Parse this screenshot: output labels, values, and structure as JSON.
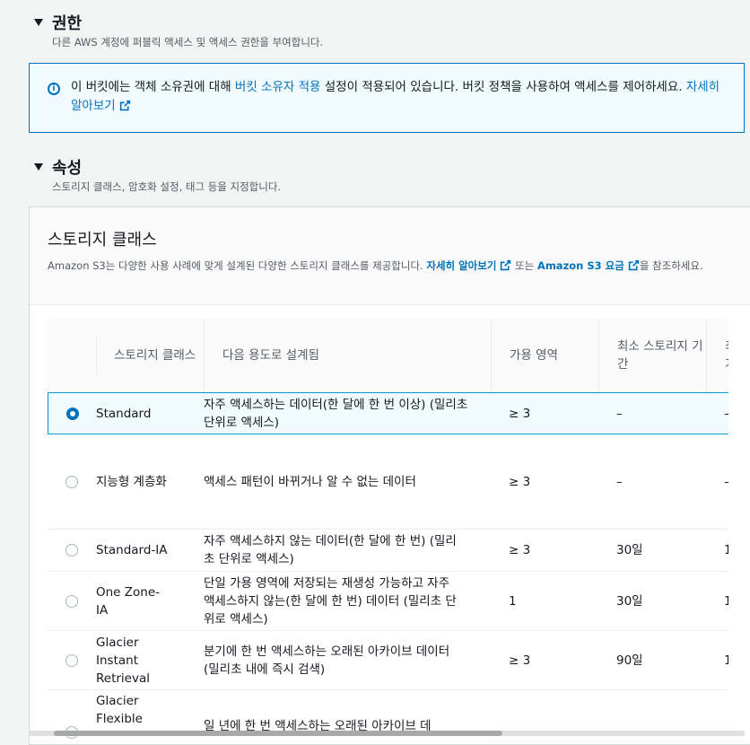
{
  "permissions": {
    "title": "권한",
    "description": "다른 AWS 계정에 퍼블릭 액세스 및 액세스 권한을 부여합니다."
  },
  "info": {
    "text_before": "이 버킷에는 객체 소유권에 대해 ",
    "link_text": "버킷 소유자 적용",
    "text_after": " 설정이 적용되어 있습니다. 버킷 정책을 사용하여 액세스를 제어하세요. ",
    "learn_more": "자세히 알아보기"
  },
  "properties": {
    "title": "속성",
    "description": "스토리지 클래스, 암호화 설정, 태그 등을 지정합니다."
  },
  "storage": {
    "title": "스토리지 클래스",
    "desc_before": "Amazon S3는 다양한 사용 사례에 맞게 설계된 다양한 스토리지 클래스를 제공합니다. ",
    "learn_more": "자세히 알아보기",
    "or_text": " 또는 ",
    "pricing": "Amazon S3 요금",
    "desc_after": "을 참조하세요."
  },
  "table": {
    "headers": [
      "스토리지 클래스",
      "다음 용도로 설계됨",
      "가용 영역",
      "최소 스토리지 기간",
      "최소 청구 가능"
    ],
    "rows": [
      {
        "name": "Standard",
        "designed": "자주 액세스하는 데이터(한 달에 한 번 이상) (밀리초 단위로 액세스)",
        "az": "≥ 3",
        "min_duration": "–",
        "extra": "–"
      },
      {
        "name": "지능형 계층화",
        "designed": "액세스 패턴이 바뀌거나 알 수 없는 데이터",
        "az": "≥ 3",
        "min_duration": "–",
        "extra": "–"
      },
      {
        "name": "Standard-IA",
        "designed": "자주 액세스하지 않는 데이터(한 달에 한 번) (밀리초 단위로 액세스)",
        "az": "≥ 3",
        "min_duration": "30일",
        "extra": "1"
      },
      {
        "name": "One Zone-IA",
        "designed": "단일 가용 영역에 저장되는 재생성 가능하고 자주 액세스하지 않는(한 달에 한 번) 데이터 (밀리초 단위로 액세스)",
        "az": "1",
        "min_duration": "30일",
        "extra": "1"
      },
      {
        "name": "Glacier Instant Retrieval",
        "designed": "분기에 한 번 액세스하는 오래된 아카이브 데이터(밀리초 내에 즉시 검색)",
        "az": "≥ 3",
        "min_duration": "90일",
        "extra": "1"
      },
      {
        "name": "Glacier Flexible",
        "designed": "일 년에 한 번 액세스하는 오래된 아카이브 데",
        "az": "",
        "min_duration": "",
        "extra": ""
      }
    ],
    "selected_index": 0
  },
  "colors": {
    "accent": "#0073bb",
    "selected_border": "#00a1c9"
  }
}
